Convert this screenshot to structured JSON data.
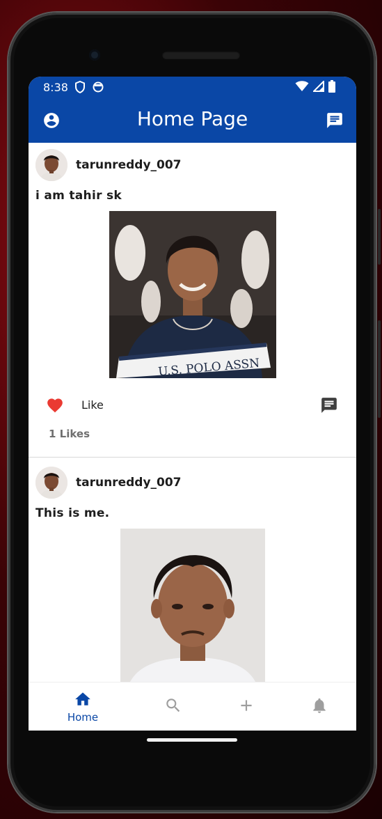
{
  "status_bar": {
    "time": "8:38",
    "icons_left": [
      "shield-icon",
      "circle-status-icon"
    ],
    "icons_right": [
      "wifi-icon",
      "signal-icon",
      "battery-icon"
    ]
  },
  "app_bar": {
    "title": "Home Page",
    "left_icon": "account-circle-icon",
    "right_icon": "message-icon",
    "color": "#0a47a6"
  },
  "posts": [
    {
      "username": "tarunreddy_007",
      "caption": "i am tahir sk",
      "like_label": "Like",
      "likes_text": "1 Likes",
      "liked": true
    },
    {
      "username": "tarunreddy_007",
      "caption": "This is me."
    }
  ],
  "bottom_nav": {
    "items": [
      {
        "label": "Home",
        "icon": "home-icon",
        "active": true
      },
      {
        "label": "",
        "icon": "search-icon",
        "active": false
      },
      {
        "label": "",
        "icon": "add-icon",
        "active": false
      },
      {
        "label": "",
        "icon": "bell-icon",
        "active": false
      }
    ]
  },
  "colors": {
    "primary": "#0a47a6",
    "heart": "#ea3a32",
    "inactive": "#9e9e9e"
  }
}
